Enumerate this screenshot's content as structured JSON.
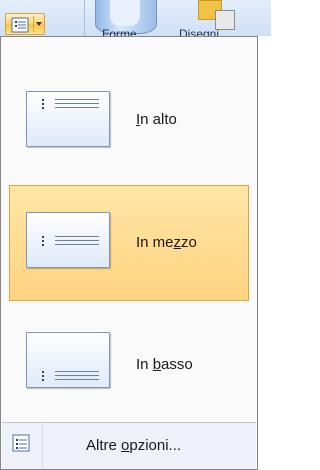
{
  "ribbon": {
    "visible_labels": [
      "Forme",
      "Disegni"
    ]
  },
  "menu": {
    "items": [
      {
        "label_pre": "",
        "label_u": "I",
        "label_post": "n alto",
        "icon": "align-top-icon",
        "selected": false
      },
      {
        "label_pre": "In me",
        "label_u": "z",
        "label_post": "zo",
        "icon": "align-middle-icon",
        "selected": true
      },
      {
        "label_pre": "In ",
        "label_u": "b",
        "label_post": "asso",
        "icon": "align-bottom-icon",
        "selected": false
      }
    ],
    "more_options": {
      "label_pre": "Altre ",
      "label_u": "o",
      "label_post": "pzioni...",
      "icon": "text-align-icon"
    }
  },
  "colors": {
    "highlight_border": "#e3a33a",
    "highlight_fill": "#ffd381"
  }
}
